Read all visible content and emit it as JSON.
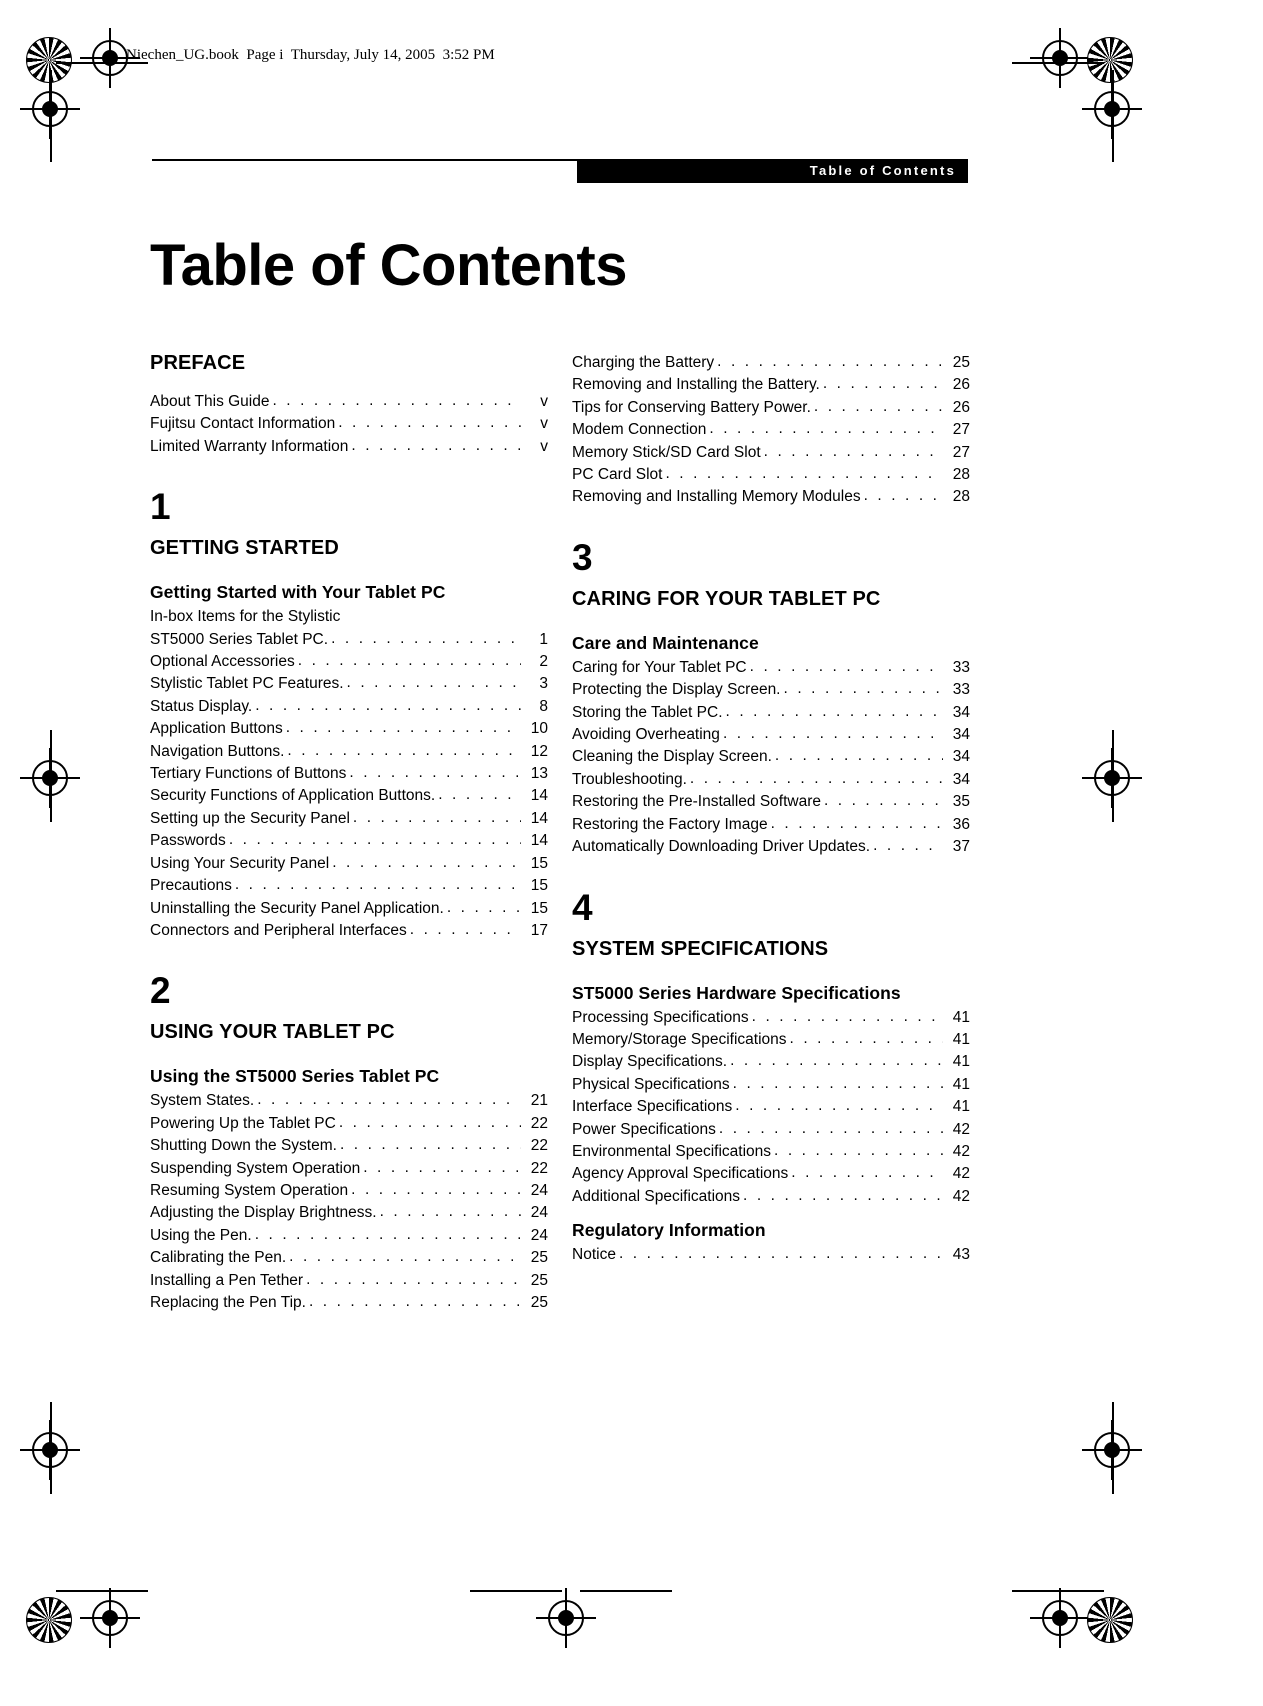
{
  "header_line": "Niechen_UG.book  Page i  Thursday, July 14, 2005  3:52 PM",
  "banner_label": "Table of Contents",
  "page_title": "Table of Contents",
  "leader_dots": ". . . . . . . . . . . . . . . . . . . . . . . . . . . . . . . . . . . . . . . . . . . . . . . . . . . . . . . . . . . . . .",
  "colors": {
    "banner_bg": "#000000",
    "banner_text": "#ffffff",
    "body_text": "#000000"
  },
  "left_column": {
    "preface": {
      "heading": "PREFACE",
      "entries": [
        {
          "title": "About This Guide",
          "page": "v"
        },
        {
          "title": "Fujitsu Contact Information",
          "page": "v"
        },
        {
          "title": "Limited Warranty Information",
          "page": "v"
        }
      ]
    },
    "chapter1": {
      "number": "1",
      "title": "GETTING STARTED",
      "subhead": "Getting Started with Your Tablet PC",
      "entries": [
        {
          "title": "In-box Items for the Stylistic",
          "page": "",
          "wrap": true
        },
        {
          "title": "ST5000 Series Tablet PC.",
          "page": "1"
        },
        {
          "title": "Optional Accessories",
          "page": "2"
        },
        {
          "title": "Stylistic Tablet PC Features.",
          "page": "3"
        },
        {
          "title": "Status Display.",
          "page": "8"
        },
        {
          "title": "Application Buttons",
          "page": "10"
        },
        {
          "title": "Navigation Buttons.",
          "page": "12"
        },
        {
          "title": "Tertiary Functions of Buttons",
          "page": "13"
        },
        {
          "title": "Security Functions of Application Buttons.",
          "page": "14"
        },
        {
          "title": "Setting up the Security Panel",
          "page": "14"
        },
        {
          "title": "Passwords",
          "page": "14"
        },
        {
          "title": "Using Your Security Panel",
          "page": "15"
        },
        {
          "title": "Precautions",
          "page": "15"
        },
        {
          "title": "Uninstalling the Security Panel Application.",
          "page": "15"
        },
        {
          "title": "Connectors and Peripheral Interfaces",
          "page": "17"
        }
      ]
    },
    "chapter2": {
      "number": "2",
      "title": "USING YOUR TABLET PC",
      "subhead": "Using the ST5000 Series Tablet PC",
      "entries": [
        {
          "title": "System States.",
          "page": "21"
        },
        {
          "title": "Powering Up the Tablet PC",
          "page": "22"
        },
        {
          "title": "Shutting Down the System.",
          "page": "22"
        },
        {
          "title": "Suspending System Operation",
          "page": "22"
        },
        {
          "title": "Resuming System Operation",
          "page": "24"
        },
        {
          "title": "Adjusting the Display Brightness.",
          "page": "24"
        },
        {
          "title": "Using the Pen.",
          "page": "24"
        },
        {
          "title": "Calibrating the Pen.",
          "page": "25"
        },
        {
          "title": "Installing a Pen Tether",
          "page": "25"
        },
        {
          "title": "Replacing the Pen Tip.",
          "page": "25"
        }
      ]
    }
  },
  "right_column": {
    "chapter2_continued": {
      "entries": [
        {
          "title": "Charging the Battery",
          "page": "25"
        },
        {
          "title": "Removing and Installing the Battery.",
          "page": "26"
        },
        {
          "title": "Tips for Conserving Battery Power.",
          "page": "26"
        },
        {
          "title": "Modem Connection",
          "page": "27"
        },
        {
          "title": "Memory Stick/SD Card Slot",
          "page": "27"
        },
        {
          "title": "PC Card Slot",
          "page": "28"
        },
        {
          "title": "Removing and Installing Memory Modules",
          "page": "28"
        }
      ]
    },
    "chapter3": {
      "number": "3",
      "title": "CARING FOR YOUR TABLET PC",
      "subhead": "Care and Maintenance",
      "entries": [
        {
          "title": "Caring for Your Tablet PC",
          "page": "33"
        },
        {
          "title": "Protecting the Display Screen.",
          "page": "33"
        },
        {
          "title": "Storing the Tablet PC.",
          "page": "34"
        },
        {
          "title": "Avoiding Overheating",
          "page": "34"
        },
        {
          "title": "Cleaning the Display Screen.",
          "page": "34"
        },
        {
          "title": "Troubleshooting.",
          "page": "34"
        },
        {
          "title": "Restoring the Pre-Installed Software",
          "page": "35"
        },
        {
          "title": "Restoring the Factory Image",
          "page": "36"
        },
        {
          "title": "Automatically Downloading Driver Updates.",
          "page": "37"
        }
      ]
    },
    "chapter4": {
      "number": "4",
      "title": "SYSTEM SPECIFICATIONS",
      "subhead": "ST5000 Series Hardware Specifications",
      "entries": [
        {
          "title": "Processing Specifications",
          "page": "41"
        },
        {
          "title": "Memory/Storage Specifications",
          "page": "41"
        },
        {
          "title": "Display Specifications.",
          "page": "41"
        },
        {
          "title": "Physical Specifications",
          "page": "41"
        },
        {
          "title": "Interface Specifications",
          "page": "41"
        },
        {
          "title": "Power Specifications",
          "page": "42"
        },
        {
          "title": "Environmental Specifications",
          "page": "42"
        },
        {
          "title": "Agency Approval Specifications",
          "page": "42"
        },
        {
          "title": "Additional Specifications",
          "page": "42"
        }
      ],
      "subhead2": "Regulatory Information",
      "entries2": [
        {
          "title": "Notice",
          "page": "43"
        }
      ]
    }
  }
}
